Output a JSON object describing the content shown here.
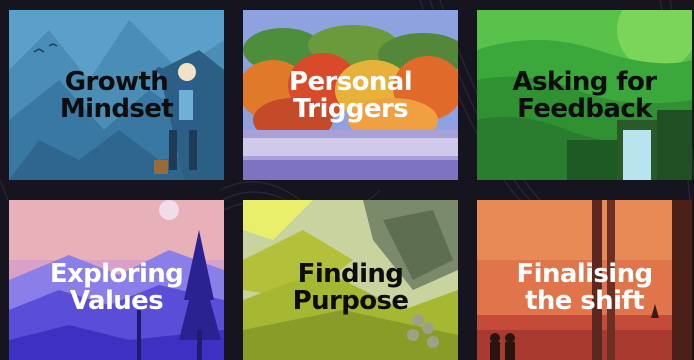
{
  "cards": [
    {
      "line1": "Growth",
      "line2": "Mindset"
    },
    {
      "line1": "Personal",
      "line2": "Triggers"
    },
    {
      "line1": "Asking for",
      "line2": "Feedback"
    },
    {
      "line1": "Exploring",
      "line2": "Values"
    },
    {
      "line1": "Finding",
      "line2": "Purpose"
    },
    {
      "line1": "Finalising",
      "line2": "the shift"
    }
  ]
}
